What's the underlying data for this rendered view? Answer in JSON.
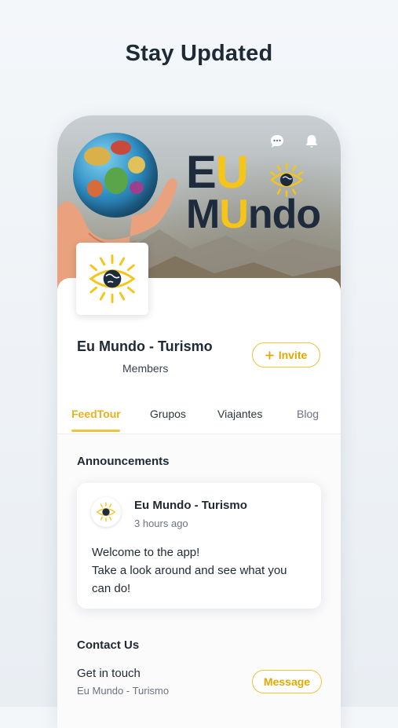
{
  "page": {
    "heading": "Stay Updated"
  },
  "cover": {
    "word_line1_part1": "E",
    "word_line1_part2": "U",
    "word_line2_part1": "M",
    "word_line2_part2": "U",
    "word_line2_part3": "ndo"
  },
  "header": {
    "chat_icon": "chat-bubble-icon",
    "bell_icon": "bell-icon"
  },
  "group": {
    "name": "Eu Mundo - Turismo",
    "members_label": "Members",
    "invite_label": "Invite",
    "invite_icon": "plus-icon"
  },
  "tabs": [
    {
      "label": "FeedTour",
      "active": true
    },
    {
      "label": "Grupos",
      "active": false
    },
    {
      "label": "Viajantes",
      "active": false
    },
    {
      "label": "Blog",
      "active": false
    }
  ],
  "announcements": {
    "title": "Announcements",
    "post": {
      "author": "Eu Mundo - Turismo",
      "time": "3 hours ago",
      "lines": [
        "Welcome to the app!",
        "Take a look around and see what you",
        "can do!"
      ]
    }
  },
  "contact": {
    "title": "Contact Us",
    "label": "Get in touch",
    "sub": "Eu Mundo - Turismo",
    "button": "Message"
  },
  "colors": {
    "accent": "#f3c23c",
    "accent_text": "#e0a800",
    "heading": "#1e2a36",
    "logo_dark": "#1d2b3c"
  }
}
